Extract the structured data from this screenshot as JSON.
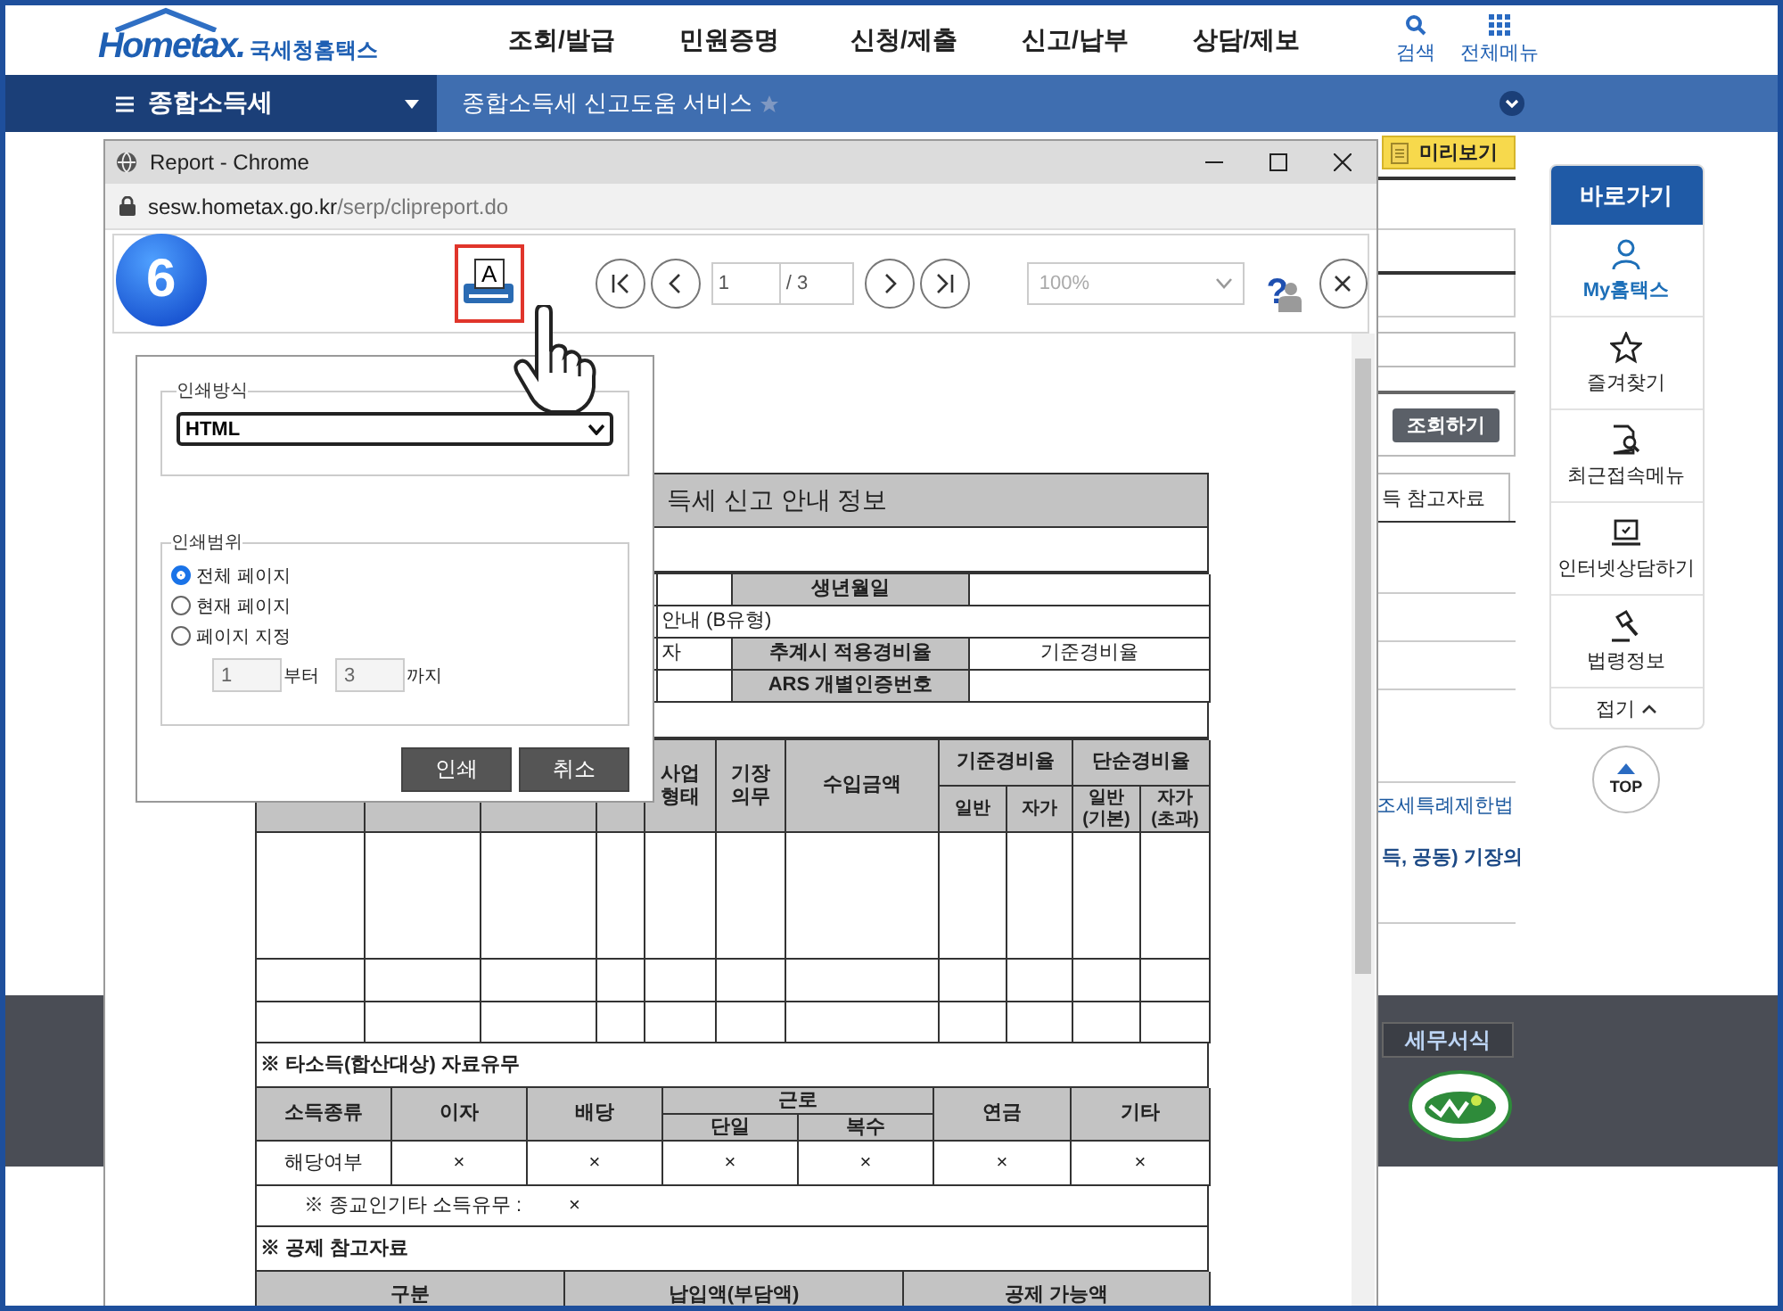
{
  "header": {
    "logo": "Hometax.",
    "brand": "국세청홈택스",
    "menu": [
      "조회/발급",
      "민원증명",
      "신청/제출",
      "신고/납부",
      "상담/제보"
    ],
    "search": "검색",
    "all_menu": "전체메뉴"
  },
  "nav": {
    "section": "종합소득세",
    "breadcrumb": "종합소득세 신고도움 서비스"
  },
  "page": {
    "preview": "미리보기",
    "search_button": "조회하기",
    "tab": "득 참고자료",
    "law_link": "조세특례제한법",
    "note": "득, 공동) 기장의"
  },
  "quick_menu": {
    "title": "바로가기",
    "items": [
      {
        "label": "My홈택스",
        "highlighted": true
      },
      {
        "label": "즐겨찾기",
        "highlighted": false
      },
      {
        "label": "최근접속메뉴",
        "highlighted": false
      },
      {
        "label": "인터넷상담하기",
        "highlighted": false
      },
      {
        "label": "법령정보",
        "highlighted": false
      }
    ],
    "collapse": "접기",
    "top": "TOP"
  },
  "footer": {
    "forms_button": "세무서식"
  },
  "popup": {
    "title": "Report - Chrome",
    "url_host": "sesw.hometax.go.kr",
    "url_path": "/serp/clipreport.do",
    "step": "6",
    "toolbar": {
      "print_label": "A",
      "print_highlighted": true,
      "page": "1",
      "total": "/ 3",
      "zoom": "100%",
      "zoom_disabled": true,
      "help": "?"
    },
    "print_dialog": {
      "method_legend": "인쇄방식",
      "method": "HTML",
      "range_legend": "인쇄범위",
      "options": [
        {
          "label": "전체 페이지",
          "selected": true
        },
        {
          "label": "현재 페이지",
          "selected": false
        },
        {
          "label": "페이지 지정",
          "selected": false
        }
      ],
      "from": "1",
      "from_label": "부터",
      "to": "3",
      "to_label": "까지",
      "buttons": [
        "인쇄",
        "취소"
      ]
    },
    "report": {
      "title": "득세 신고 안내 정보",
      "info_rows": [
        {
          "kind": "pair",
          "label": "생년월일"
        },
        {
          "kind": "note",
          "text": "안내 (B유형)"
        },
        {
          "kind": "pair",
          "lead": "자",
          "label": "추계시 적용경비율",
          "value": "기준경비율"
        },
        {
          "kind": "pair",
          "label": "ARS 개별인증번호"
        }
      ],
      "income_columns": [
        "사업\n형태",
        "기장\n의무",
        "수입금액"
      ],
      "rate_groups": [
        {
          "label": "기준경비율",
          "sub": [
            "일반",
            "자가"
          ]
        },
        {
          "label": "단순경비율",
          "sub": [
            "일반\n(기본)",
            "자가\n(초과)"
          ]
        }
      ],
      "other_heading": "※ 타소득(합산대상) 자료유무",
      "other_row_header": "소득종류",
      "other_columns": [
        {
          "label": "이자"
        },
        {
          "label": "배당"
        },
        {
          "label": "근로",
          "sub": [
            "단일",
            "복수"
          ]
        },
        {
          "label": "연금"
        },
        {
          "label": "기타"
        }
      ],
      "other_row_label": "해당여부",
      "other_marks": [
        "×",
        "×",
        "×",
        "×",
        "×",
        "×"
      ],
      "religious_label": "※ 종교인기타 소득유무 :",
      "religious_mark": "×",
      "deduction_heading": "※ 공제 참고자료",
      "deduction_columns": [
        "구분",
        "납입액(부담액)",
        "공제 가능액"
      ]
    }
  }
}
